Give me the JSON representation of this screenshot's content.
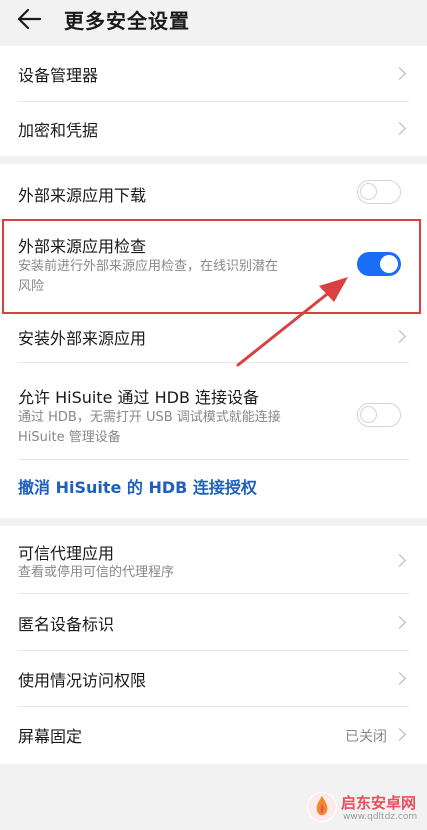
{
  "header": {
    "title": "更多安全设置",
    "back_icon": "arrow-left-icon"
  },
  "group1": {
    "items": [
      {
        "label": "设备管理器"
      },
      {
        "label": "加密和凭据"
      }
    ]
  },
  "group2": {
    "download": {
      "label": "外部来源应用下载",
      "toggle": "off"
    },
    "check": {
      "label": "外部来源应用检查",
      "subtitle_line1": "安装前进行外部来源应用检查，在线识别潜在",
      "subtitle_line2": "风险",
      "toggle": "on"
    },
    "install": {
      "label": "安装外部来源应用"
    },
    "hdb": {
      "label": "允许 HiSuite 通过 HDB 连接设备",
      "subtitle_line1": "通过 HDB，无需打开 USB 调试模式就能连接",
      "subtitle_line2": "HiSuite 管理设备",
      "toggle": "off"
    },
    "revoke_link": "撤消 HiSuite 的 HDB 连接授权"
  },
  "group3": {
    "trusted": {
      "label": "可信代理应用",
      "subtitle": "查看或停用可信的代理程序"
    },
    "anon": {
      "label": "匿名设备标识"
    },
    "usage": {
      "label": "使用情况访问权限"
    },
    "pin": {
      "label": "屏幕固定",
      "value": "已关闭"
    }
  },
  "watermark": {
    "brand": "启东安卓网",
    "url": "www.qdltdz.com"
  },
  "colors": {
    "accent": "#1a6ef5",
    "annotation": "#d94040",
    "link": "#1f5fbf"
  }
}
